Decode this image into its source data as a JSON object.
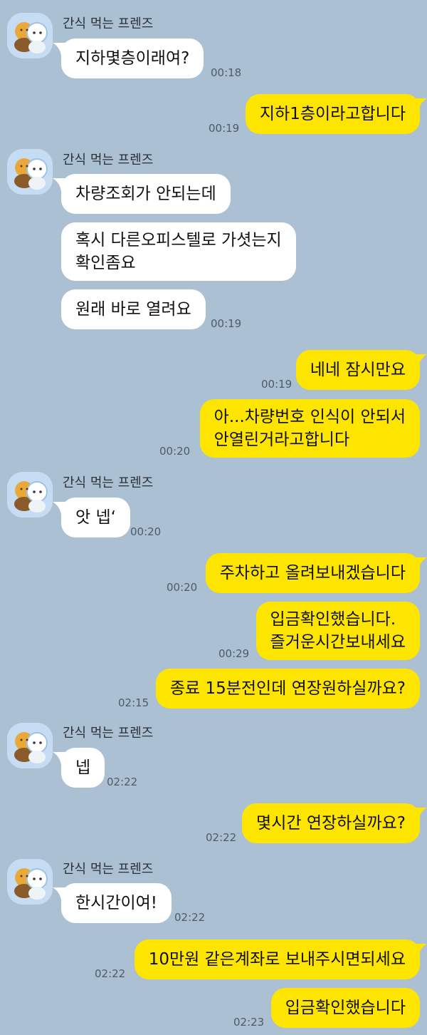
{
  "sender_name": "간식 먹는 프렌즈",
  "messages": [
    {
      "text": "지하몇층이래여?",
      "time": "00:18"
    },
    {
      "text": "지하1층이라고합니다",
      "time": "00:19"
    },
    {
      "text": "차량조회가 안되는데"
    },
    {
      "line1": "혹시 다른오피스텔로 가셧는지",
      "line2": "확인좀요"
    },
    {
      "text": "원래 바로 열려요",
      "time": "00:19"
    },
    {
      "text": "네네 잠시만요",
      "time": "00:19"
    },
    {
      "line1": "아...차량번호 인식이 안되서",
      "line2": "안열린거라고합니다",
      "time": "00:20"
    },
    {
      "text": "앗 넵‘",
      "time": "00:20"
    },
    {
      "text": "주차하고 올려보내겠습니다",
      "time": "00:20"
    },
    {
      "line1": "입금확인했습니다.",
      "line2": "즐거운시간보내세요",
      "time": "00:29"
    },
    {
      "text": "종료 15분전인데 연장원하실까요?",
      "time": "02:15"
    },
    {
      "text": "넵",
      "time": "02:22"
    },
    {
      "text": "몇시간 연장하실까요?",
      "time": "02:22"
    },
    {
      "text": "한시간이여!",
      "time": "02:22"
    },
    {
      "text": "10만원 같은계좌로 보내주시면되세요",
      "time": "02:22"
    },
    {
      "text": "입금확인했습니다",
      "time": "02:23"
    }
  ],
  "colors": {
    "background": "#abc0d2",
    "incoming_bubble": "#ffffff",
    "outgoing_bubble": "#fee500",
    "avatar_bg": "#c5dcf2"
  }
}
